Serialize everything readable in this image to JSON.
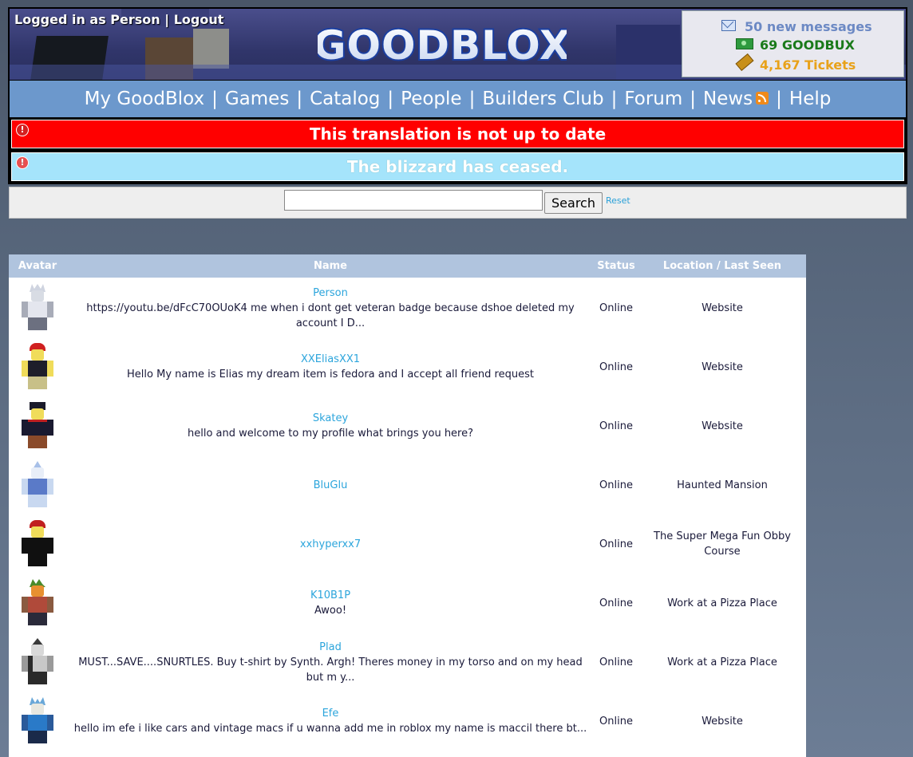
{
  "header": {
    "logged_in_text": "Logged in as Person",
    "separator": "|",
    "logout_label": "Logout",
    "logo_text": "GOODBLOX"
  },
  "stats": {
    "messages": "50 new messages",
    "goodbux": "69 GOODBUX",
    "tickets": "4,167 Tickets"
  },
  "nav": {
    "items": [
      "My GoodBlox",
      "Games",
      "Catalog",
      "People",
      "Builders Club",
      "Forum",
      "News",
      "Help"
    ],
    "separator": "|"
  },
  "alerts": [
    {
      "text": "This translation is not up to date",
      "color": "#ff0000"
    },
    {
      "text": "The blizzard has ceased.",
      "color": "#a5e4fb"
    }
  ],
  "search": {
    "value": "",
    "button_label": "Search",
    "reset_label": "Reset"
  },
  "table": {
    "headers": [
      "Avatar",
      "Name",
      "Status",
      "Location / Last Seen"
    ],
    "rows": [
      {
        "name": "Person",
        "blurb": "https://youtu.be/dFcC70OUoK4 me when i dont get veteran badge because dshoe deleted my account I D...",
        "status": "Online",
        "location": "Website"
      },
      {
        "name": "XXEliasXX1",
        "blurb": "Hello My name is Elias my dream item is fedora and I accept all friend request",
        "status": "Online",
        "location": "Website"
      },
      {
        "name": "Skatey",
        "blurb": "hello and welcome to my profile what brings you here?",
        "status": "Online",
        "location": "Website"
      },
      {
        "name": "BluGlu",
        "blurb": "",
        "status": "Online",
        "location": "Haunted Mansion"
      },
      {
        "name": "xxhyperxx7",
        "blurb": "",
        "status": "Online",
        "location": "The Super Mega Fun Obby Course"
      },
      {
        "name": "K10B1P",
        "blurb": "Awoo!",
        "status": "Online",
        "location": "Work at a Pizza Place"
      },
      {
        "name": "Plad",
        "blurb": "MUST...SAVE....SNURTLES. Buy t-shirt by Synth. Argh! Theres money in my torso and on my head but m y...",
        "status": "Online",
        "location": "Work at a Pizza Place"
      },
      {
        "name": "Efe",
        "blurb": "hello im efe i like cars and vintage macs if u wanna add me in roblox my name is maccil there bt...",
        "status": "Online",
        "location": "Website"
      }
    ]
  },
  "colors": {
    "nav_bg": "#6c98cc",
    "table_header_bg": "#b0c4de",
    "username_link": "#2ca5dc",
    "goodbux": "#1a7a1a",
    "tickets": "#e8a21a",
    "messages": "#6c89c4"
  },
  "icons": {
    "messages": "envelope-icon",
    "goodbux": "money-icon",
    "tickets": "ticket-icon",
    "news": "rss-icon",
    "alert": "exclamation-icon"
  }
}
